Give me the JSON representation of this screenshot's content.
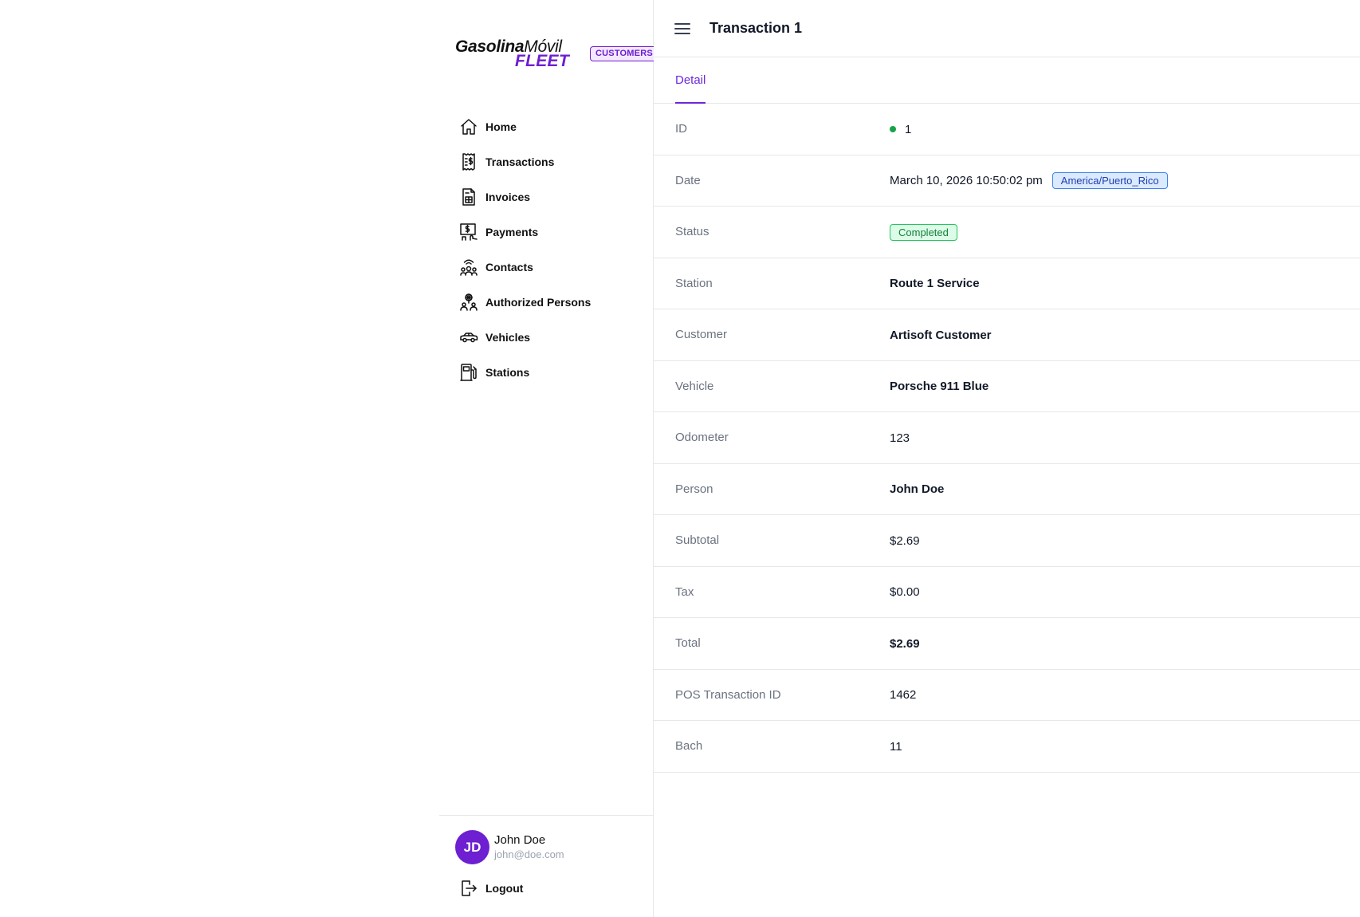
{
  "brand": {
    "name_part1": "Gasolina",
    "name_part2": "Móvil",
    "sub": "FLEET",
    "badge": "CUSTOMERS"
  },
  "nav": {
    "items": [
      {
        "label": "Home",
        "icon": "home-icon"
      },
      {
        "label": "Transactions",
        "icon": "receipt-icon"
      },
      {
        "label": "Invoices",
        "icon": "invoice-icon"
      },
      {
        "label": "Payments",
        "icon": "payment-icon"
      },
      {
        "label": "Contacts",
        "icon": "contacts-icon"
      },
      {
        "label": "Authorized Persons",
        "icon": "authorized-persons-icon"
      },
      {
        "label": "Vehicles",
        "icon": "car-icon"
      },
      {
        "label": "Stations",
        "icon": "fuel-pump-icon"
      }
    ]
  },
  "user": {
    "initials": "JD",
    "name": "John Doe",
    "email": "john@doe.com",
    "logout_label": "Logout"
  },
  "header": {
    "title": "Transaction 1"
  },
  "tabs": [
    {
      "label": "Detail",
      "active": true
    }
  ],
  "details": {
    "id": {
      "label": "ID",
      "value": "1"
    },
    "date": {
      "label": "Date",
      "value": "March 10, 2026 10:50:02 pm",
      "timezone": "America/Puerto_Rico"
    },
    "status": {
      "label": "Status",
      "value": "Completed"
    },
    "station": {
      "label": "Station",
      "value": "Route 1 Service"
    },
    "customer": {
      "label": "Customer",
      "value": "Artisoft Customer"
    },
    "vehicle": {
      "label": "Vehicle",
      "value": "Porsche 911 Blue"
    },
    "odometer": {
      "label": "Odometer",
      "value": "123"
    },
    "person": {
      "label": "Person",
      "value": "John Doe"
    },
    "subtotal": {
      "label": "Subtotal",
      "value": "$2.69"
    },
    "tax": {
      "label": "Tax",
      "value": "$0.00"
    },
    "total": {
      "label": "Total",
      "value": "$2.69"
    },
    "pos_transaction_id": {
      "label": "POS Transaction ID",
      "value": "1462"
    },
    "bach": {
      "label": "Bach",
      "value": "11"
    }
  },
  "colors": {
    "accent": "#6d1fd1",
    "status_completed": "#16a34a",
    "timezone_badge": "#3b82f6"
  }
}
